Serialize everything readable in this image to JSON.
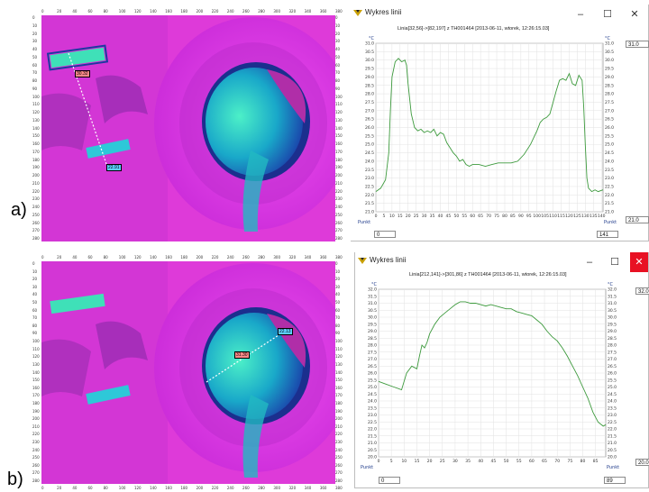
{
  "panels": [
    {
      "label": "a)",
      "xticks": [
        "0",
        "20",
        "40",
        "60",
        "80",
        "100",
        "120",
        "140",
        "160",
        "180",
        "200",
        "220",
        "240",
        "260",
        "280",
        "300",
        "320",
        "340",
        "360",
        "380"
      ],
      "yticks": [
        "0",
        "10",
        "20",
        "30",
        "40",
        "50",
        "60",
        "70",
        "80",
        "90",
        "100",
        "110",
        "120",
        "130",
        "140",
        "150",
        "160",
        "170",
        "180",
        "190",
        "200",
        "210",
        "220",
        "230",
        "240",
        "250",
        "260",
        "270",
        "280"
      ],
      "markers": [
        "30.32",
        "22.91"
      ],
      "window_title": "Wykres linii",
      "graph_title": "Linia[32,56]->[82,197] z TH001464 [2013-06-11, wtorek, 12:26:15.03]",
      "unit_left": "°C",
      "unit_right": "°C",
      "punkt_left": "Punkt",
      "punkt_right": "Punkt",
      "max_field": "31.0",
      "min_field": "21.0",
      "start_field": "0",
      "end_field": "141",
      "chart_data": {
        "type": "line",
        "xlabel": "Punkt",
        "ylabel": "°C",
        "xlim": [
          0,
          141
        ],
        "ylim": [
          21.0,
          31.0
        ],
        "xticks": [
          0,
          5,
          10,
          15,
          20,
          25,
          30,
          35,
          40,
          45,
          50,
          55,
          60,
          65,
          70,
          75,
          80,
          85,
          90,
          95,
          100,
          105,
          110,
          115,
          120,
          125,
          130,
          135,
          140
        ],
        "yticks": [
          21.0,
          21.5,
          22.0,
          22.5,
          23.0,
          23.5,
          24.0,
          24.5,
          25.0,
          25.5,
          26.0,
          26.5,
          27.0,
          27.5,
          28.0,
          28.5,
          29.0,
          29.5,
          30.0,
          30.5,
          31.0
        ],
        "grid": true,
        "series": [
          {
            "color": "#3d9a3d",
            "x": [
              0,
              3,
              6,
              8,
              9,
              10,
              12,
              14,
              16,
              18,
              19,
              20,
              22,
              24,
              26,
              28,
              30,
              32,
              34,
              36,
              38,
              40,
              42,
              44,
              46,
              48,
              50,
              52,
              54,
              56,
              58,
              60,
              64,
              68,
              72,
              76,
              80,
              84,
              88,
              92,
              96,
              100,
              102,
              104,
              106,
              108,
              110,
              112,
              114,
              116,
              118,
              120,
              122,
              124,
              126,
              128,
              129,
              130,
              131,
              132,
              134,
              136,
              138,
              141
            ],
            "y": [
              22.2,
              22.4,
              22.9,
              24.5,
              27.0,
              29.0,
              29.9,
              30.1,
              29.9,
              30.0,
              29.7,
              28.6,
              26.8,
              26.0,
              25.8,
              25.9,
              25.7,
              25.8,
              25.7,
              25.9,
              25.5,
              25.7,
              25.6,
              25.1,
              24.8,
              24.5,
              24.3,
              24.0,
              24.1,
              23.8,
              23.7,
              23.8,
              23.8,
              23.7,
              23.8,
              23.9,
              23.9,
              23.9,
              24.0,
              24.4,
              25.0,
              25.8,
              26.3,
              26.5,
              26.6,
              26.8,
              27.5,
              28.2,
              28.8,
              28.9,
              28.8,
              29.2,
              28.6,
              28.5,
              29.1,
              28.8,
              27.2,
              25.0,
              23.0,
              22.4,
              22.2,
              22.3,
              22.2,
              22.3
            ]
          }
        ]
      }
    },
    {
      "label": "b)",
      "xticks": [
        "0",
        "20",
        "40",
        "60",
        "80",
        "100",
        "120",
        "140",
        "160",
        "180",
        "200",
        "220",
        "240",
        "260",
        "280",
        "300",
        "320",
        "340",
        "360",
        "380"
      ],
      "yticks": [
        "0",
        "10",
        "20",
        "30",
        "40",
        "50",
        "60",
        "70",
        "80",
        "90",
        "100",
        "110",
        "120",
        "130",
        "140",
        "150",
        "160",
        "170",
        "180",
        "190",
        "200",
        "210",
        "220",
        "230",
        "240",
        "250",
        "260",
        "270",
        "280"
      ],
      "markers": [
        "22.13",
        "31.30"
      ],
      "window_title": "Wykres linii",
      "graph_title": "Linia[212,141]->[301,86] z TH001464 [2013-06-11, wtorek, 12:26:15.03]",
      "unit_left": "°C",
      "unit_right": "°C",
      "punkt_left": "Punkt",
      "punkt_right": "Punkt",
      "max_field": "32.0",
      "min_field": "20.0",
      "start_field": "0",
      "end_field": "89",
      "chart_data": {
        "type": "line",
        "xlabel": "Punkt",
        "ylabel": "°C",
        "xlim": [
          0,
          89
        ],
        "ylim": [
          20.0,
          32.0
        ],
        "xticks": [
          0,
          5,
          10,
          15,
          20,
          25,
          30,
          35,
          40,
          45,
          50,
          55,
          60,
          65,
          70,
          75,
          80,
          85
        ],
        "yticks": [
          20.0,
          20.5,
          21.0,
          21.5,
          22.0,
          22.5,
          23.0,
          23.5,
          24.0,
          24.5,
          25.0,
          25.5,
          26.0,
          26.5,
          27.0,
          27.5,
          28.0,
          28.5,
          29.0,
          29.5,
          30.0,
          30.5,
          31.0,
          31.5,
          32.0
        ],
        "grid": true,
        "series": [
          {
            "color": "#3d9a3d",
            "x": [
              0,
              3,
              6,
              9,
              11,
              13,
              15,
              16,
              17,
              18,
              19,
              20,
              22,
              24,
              26,
              28,
              30,
              32,
              34,
              36,
              38,
              40,
              42,
              44,
              46,
              48,
              50,
              52,
              54,
              56,
              58,
              60,
              62,
              64,
              66,
              68,
              70,
              72,
              74,
              76,
              78,
              80,
              82,
              84,
              86,
              88,
              89
            ],
            "y": [
              25.4,
              25.2,
              25.0,
              24.8,
              26.0,
              26.5,
              26.3,
              27.2,
              28.0,
              27.8,
              28.2,
              28.8,
              29.5,
              30.0,
              30.3,
              30.6,
              30.9,
              31.1,
              31.1,
              31.0,
              31.0,
              30.9,
              30.8,
              30.9,
              30.8,
              30.7,
              30.6,
              30.6,
              30.4,
              30.3,
              30.2,
              30.1,
              29.8,
              29.5,
              29.0,
              28.6,
              28.3,
              27.8,
              27.2,
              26.5,
              25.8,
              25.0,
              24.2,
              23.2,
              22.5,
              22.2,
              22.3
            ]
          }
        ]
      }
    }
  ]
}
